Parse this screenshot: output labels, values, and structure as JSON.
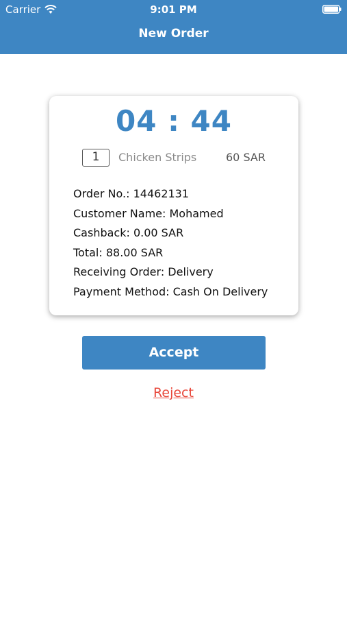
{
  "status_bar": {
    "carrier": "Carrier",
    "time": "9:01 PM"
  },
  "header": {
    "title": "New Order"
  },
  "order": {
    "timer": "04 : 44",
    "item": {
      "quantity": "1",
      "name": "Chicken Strips",
      "price": "60 SAR"
    },
    "details": [
      "Order No.: 14462131",
      "Customer Name: Mohamed",
      "Cashback: 0.00 SAR",
      "Total: 88.00 SAR",
      "Receiving Order: Delivery",
      "Payment Method: Cash On Delivery"
    ]
  },
  "actions": {
    "accept_label": "Accept",
    "reject_label": "Reject"
  },
  "colors": {
    "brand": "#3e86c3",
    "reject": "#e8473a"
  },
  "icons": [
    "wifi-icon",
    "battery-icon"
  ]
}
